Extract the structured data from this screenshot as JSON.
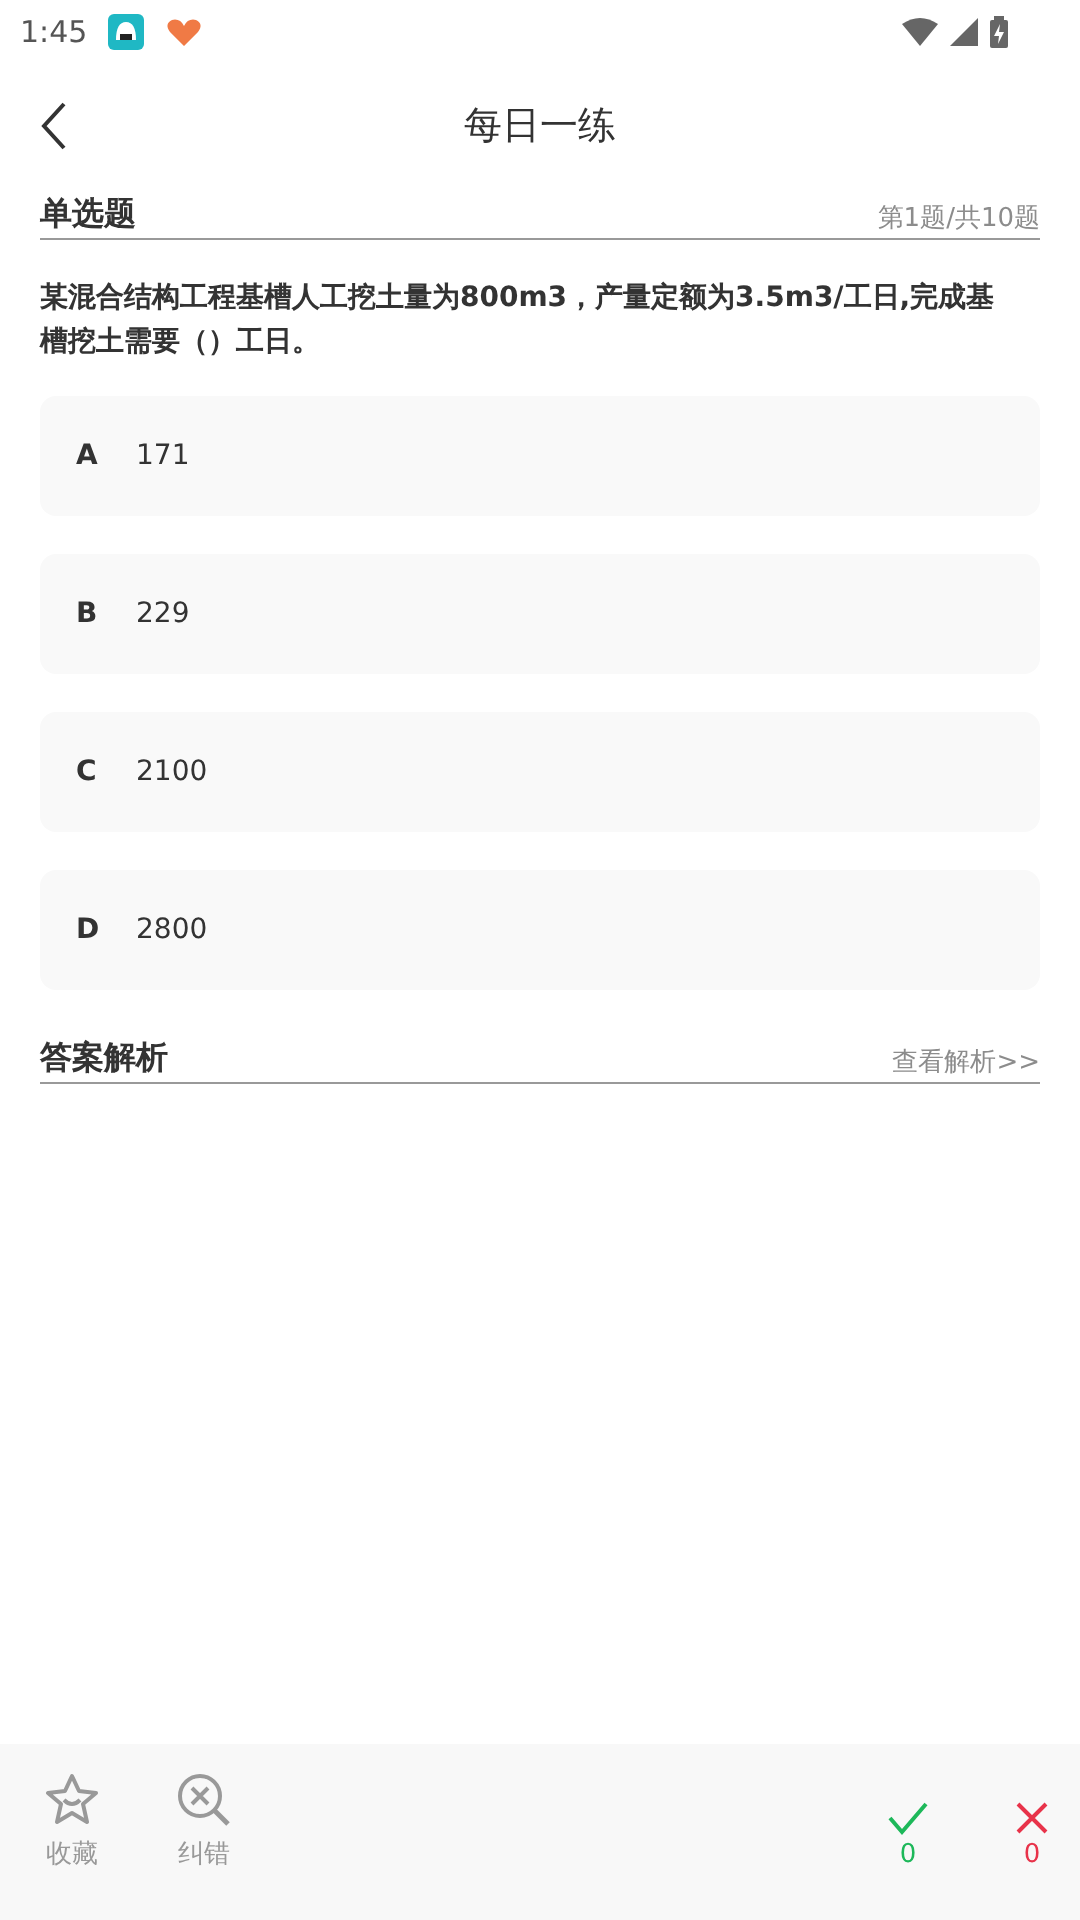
{
  "status_bar": {
    "time": "1:45"
  },
  "header": {
    "title": "每日一练"
  },
  "question": {
    "type_label": "单选题",
    "progress": "第1题/共10题",
    "text": "某混合结构工程基槽人工挖土量为800m3，产量定额为3.5m3/工日,完成基槽挖土需要（）工日。"
  },
  "options": [
    {
      "letter": "A",
      "text": "171",
      "selected": false
    },
    {
      "letter": "B",
      "text": "229",
      "selected": false
    },
    {
      "letter": "C",
      "text": "2100",
      "selected": false
    },
    {
      "letter": "D",
      "text": "2800",
      "selected": false
    }
  ],
  "analysis": {
    "title": "答案解析",
    "link": "查看解析>>"
  },
  "bottom_bar": {
    "actions": [
      {
        "kind": "star",
        "label": "收藏"
      },
      {
        "kind": "report",
        "label": "纠错"
      }
    ],
    "correct_count": "0",
    "wrong_count": "0"
  }
}
